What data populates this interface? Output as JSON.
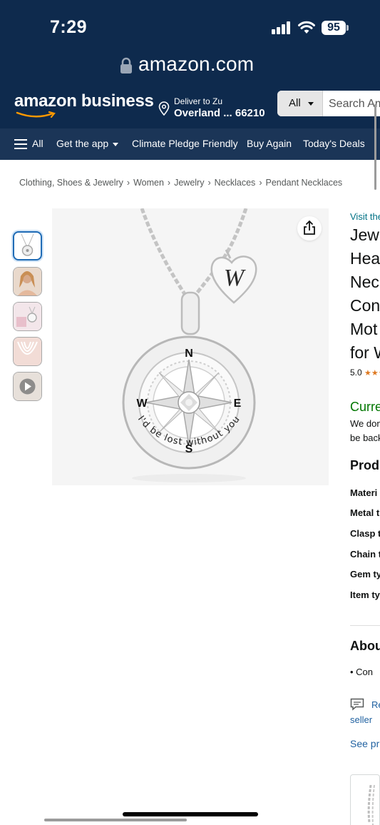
{
  "status_bar": {
    "time": "7:29",
    "battery": "95"
  },
  "browser": {
    "url": "amazon.com"
  },
  "header": {
    "logo": "amazon business",
    "deliver_to": "Deliver to Zu",
    "location": "Overland ... 66210",
    "search_category": "All",
    "search_placeholder": "Search Amazon"
  },
  "nav": {
    "items": [
      "All",
      "Get the app",
      "Climate Pledge Friendly",
      "Buy Again",
      "Today's Deals"
    ]
  },
  "breadcrumb": [
    "Clothing, Shoes & Jewelry",
    "Women",
    "Jewelry",
    "Necklaces",
    "Pendant Necklaces"
  ],
  "gallery": {
    "pendant_letter": "W",
    "compass_letters": {
      "n": "N",
      "e": "E",
      "s": "S",
      "w": "W"
    },
    "engraving": "I'd be lost without you"
  },
  "product": {
    "visit_store": "Visit the",
    "title_lines": [
      "Jew",
      "Hea",
      "Nec",
      "Con",
      "Mot",
      "for W"
    ],
    "rating": "5.0",
    "availability": "Curre",
    "availability_note_1": "We don",
    "availability_note_2": "be back",
    "product_heading": "Prod",
    "attributes": [
      "Materi",
      "Metal t",
      "Clasp t",
      "Chain t",
      "Gem ty",
      "Item ty"
    ],
    "about_heading": "Abou",
    "bullet": "Con",
    "report_1": "Re",
    "report_2": "seller",
    "see_product": "See pr"
  }
}
